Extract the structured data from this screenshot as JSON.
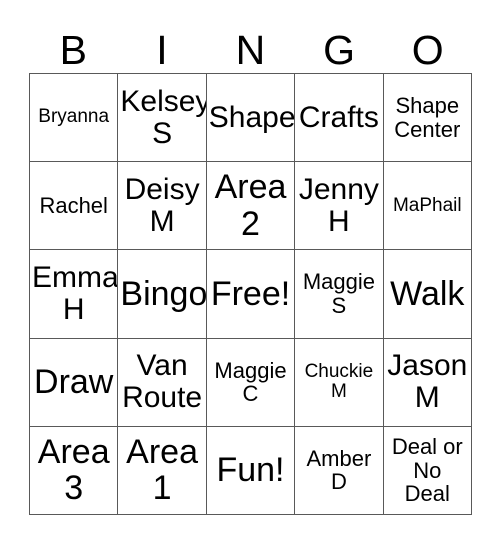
{
  "card": {
    "type": "bingo-card",
    "header_letters": [
      "B",
      "I",
      "N",
      "G",
      "O"
    ],
    "columns": 5,
    "rows": 5,
    "border_color": "#595959",
    "background_color": "#ffffff",
    "text_color": "#000000",
    "free_space": {
      "row": 3,
      "column": 3,
      "label": "Free!"
    },
    "cells": [
      {
        "text": "Bryanna",
        "size": "s"
      },
      {
        "text": "Kelsey\nS",
        "size": "xl"
      },
      {
        "text": "Shape",
        "size": "xl"
      },
      {
        "text": "Crafts",
        "size": "xl"
      },
      {
        "text": "Shape\nCenter",
        "size": "m"
      },
      {
        "text": "Rachel",
        "size": "m"
      },
      {
        "text": "Deisy\nM",
        "size": "xl"
      },
      {
        "text": "Area\n2",
        "size": "xxl"
      },
      {
        "text": "Jenny\nH",
        "size": "xl"
      },
      {
        "text": "MaPhail",
        "size": "s"
      },
      {
        "text": "Emma\nH",
        "size": "xl"
      },
      {
        "text": "Bingo",
        "size": "xxl"
      },
      {
        "text": "Free!",
        "size": "xxl"
      },
      {
        "text": "Maggie\nS",
        "size": "m"
      },
      {
        "text": "Walk",
        "size": "xxl"
      },
      {
        "text": "Draw",
        "size": "xxl"
      },
      {
        "text": "Van\nRoute",
        "size": "xl"
      },
      {
        "text": "Maggie\nC",
        "size": "m"
      },
      {
        "text": "Chuckie\nM",
        "size": "s"
      },
      {
        "text": "Jason\nM",
        "size": "xl"
      },
      {
        "text": "Area\n3",
        "size": "xxl"
      },
      {
        "text": "Area\n1",
        "size": "xxl"
      },
      {
        "text": "Fun!",
        "size": "xxl"
      },
      {
        "text": "Amber\nD",
        "size": "m"
      },
      {
        "text": "Deal or\nNo\nDeal",
        "size": "m"
      }
    ]
  }
}
